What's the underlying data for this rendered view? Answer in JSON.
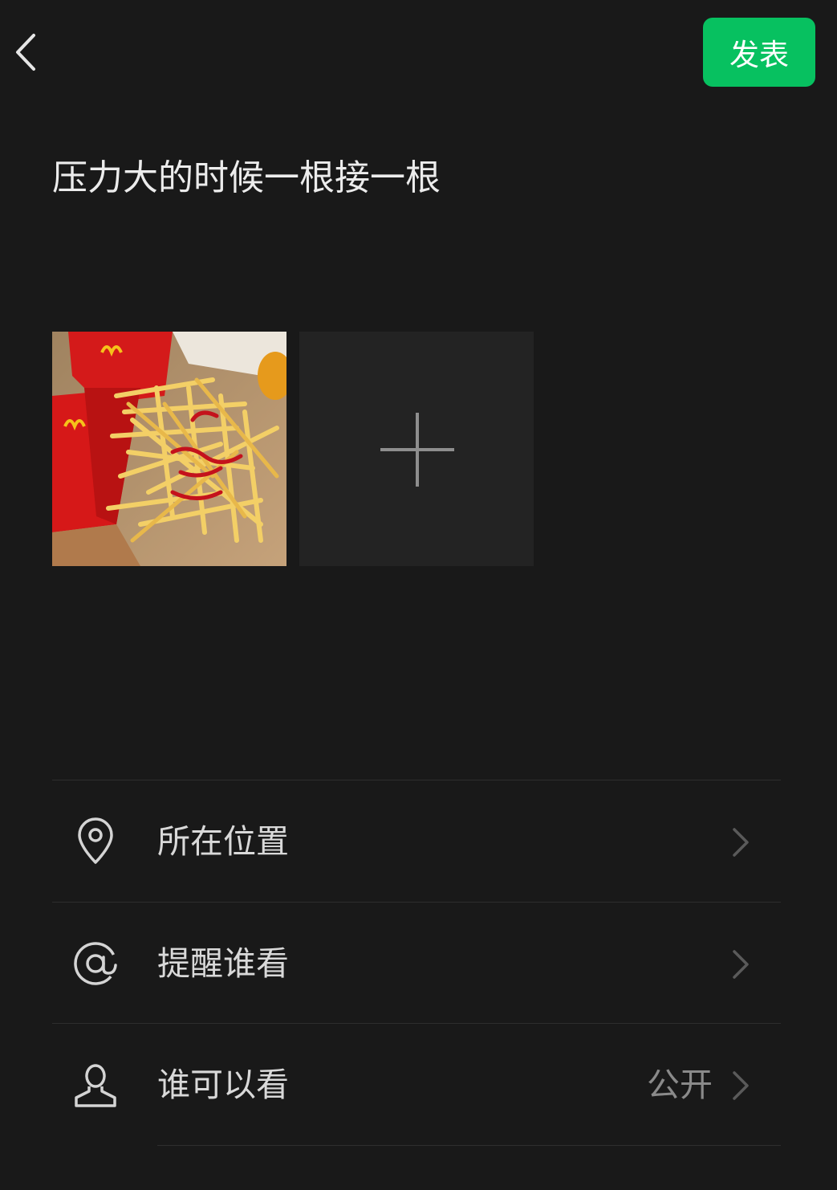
{
  "header": {
    "publish_label": "发表"
  },
  "post": {
    "text": "压力大的时候一根接一根"
  },
  "photos": {
    "count": 1
  },
  "options": [
    {
      "label": "所在位置",
      "value": ""
    },
    {
      "label": "提醒谁看",
      "value": ""
    },
    {
      "label": "谁可以看",
      "value": "公开"
    }
  ],
  "colors": {
    "accent": "#07c160",
    "background": "#191919",
    "tile": "#232323"
  }
}
